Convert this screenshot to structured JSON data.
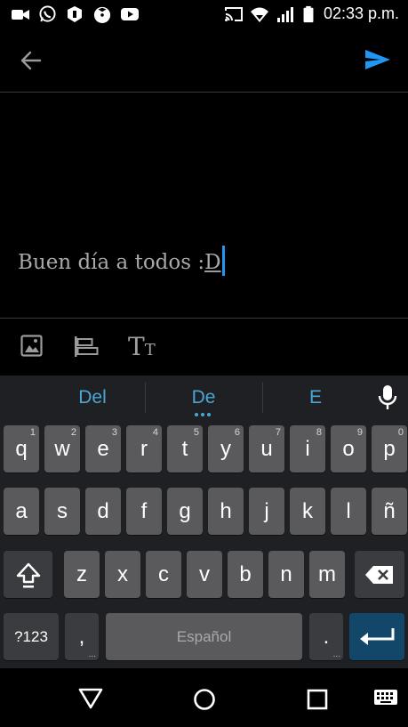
{
  "status_bar": {
    "time": "02:33 p.m.",
    "left_icons": [
      "video-camera-icon",
      "whatsapp-icon",
      "shield-icon",
      "tomato-icon",
      "youtube-icon"
    ],
    "right_icons": [
      "cast-icon",
      "wifi-icon",
      "signal-icon",
      "battery-icon"
    ]
  },
  "toolbar": {
    "back_icon": "arrow-left-icon",
    "send_icon": "send-icon",
    "accent": "#2196f3"
  },
  "editor": {
    "text_before": "Buen día a todos :",
    "text_underlined": "D"
  },
  "format_bar": {
    "icons": [
      "image-icon",
      "align-icon",
      "text-size-icon"
    ],
    "text_size_label_big": "T",
    "text_size_label_small": "T"
  },
  "keyboard": {
    "suggestions": [
      "Del",
      "De",
      "E"
    ],
    "mic_icon": "microphone-icon",
    "row1": [
      {
        "k": "q",
        "h": "1"
      },
      {
        "k": "w",
        "h": "2"
      },
      {
        "k": "e",
        "h": "3"
      },
      {
        "k": "r",
        "h": "4"
      },
      {
        "k": "t",
        "h": "5"
      },
      {
        "k": "y",
        "h": "6"
      },
      {
        "k": "u",
        "h": "7"
      },
      {
        "k": "i",
        "h": "8"
      },
      {
        "k": "o",
        "h": "9"
      },
      {
        "k": "p",
        "h": "0"
      }
    ],
    "row2": [
      "a",
      "s",
      "d",
      "f",
      "g",
      "h",
      "j",
      "k",
      "l",
      "ñ"
    ],
    "row3": [
      "z",
      "x",
      "c",
      "v",
      "b",
      "n",
      "m"
    ],
    "symbols_label": "?123",
    "comma_label": ",",
    "space_label": "Español",
    "period_label": "."
  },
  "nav_bar": {
    "icons": [
      "back-triangle-icon",
      "home-circle-icon",
      "recents-square-icon",
      "keyboard-switch-icon"
    ]
  }
}
